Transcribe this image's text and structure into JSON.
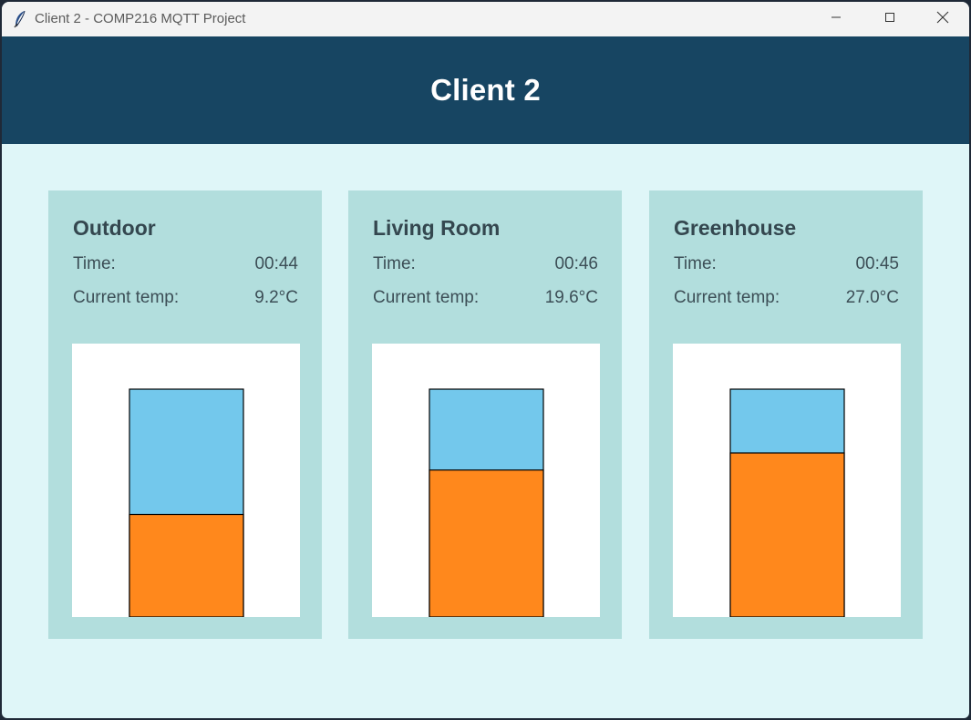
{
  "window": {
    "title": "Client 2 - COMP216 MQTT Project",
    "icon": "feather-icon",
    "controls": [
      "minimize-icon",
      "maximize-icon",
      "close-icon"
    ]
  },
  "header": {
    "title": "Client 2"
  },
  "colors": {
    "header_bg": "#174562",
    "page_bg": "#dff6f8",
    "card_bg": "#b2dedd",
    "empty_fill": "#73c8ec",
    "temp_fill": "#ff881c"
  },
  "labels": {
    "time": "Time:",
    "current_temp": "Current temp:"
  },
  "cards": [
    {
      "name": "Outdoor",
      "time": "00:44",
      "temp": "9.2°C",
      "level": 0.45
    },
    {
      "name": "Living Room",
      "time": "00:46",
      "temp": "19.6°C",
      "level": 0.645
    },
    {
      "name": "Greenhouse",
      "time": "00:45",
      "temp": "27.0°C",
      "level": 0.72
    }
  ]
}
